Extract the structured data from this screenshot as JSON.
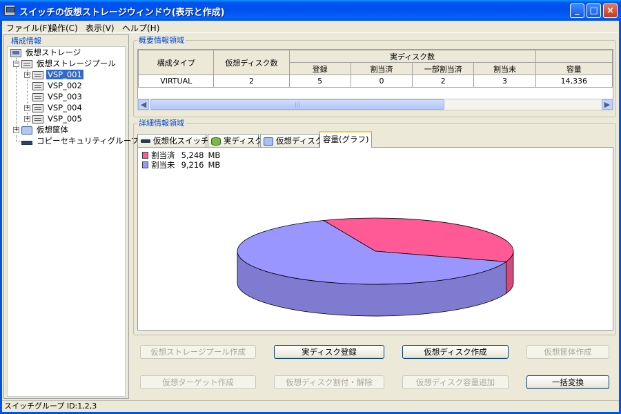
{
  "window": {
    "title": "スイッチの仮想ストレージウィンドウ(表示と作成)",
    "minimize": "_",
    "maximize": "□",
    "close": "×"
  },
  "menu": [
    "ファイル(F)",
    "操作(C)",
    "表示(V)",
    "ヘルプ(H)"
  ],
  "left": {
    "group_label": "構成情報",
    "tree": {
      "root": "仮想ストレージ",
      "pool": "仮想ストレージプール",
      "vsps": [
        "VSP_001",
        "VSP_002",
        "VSP_003",
        "VSP_004",
        "VSP_005"
      ],
      "selected": "VSP_001",
      "chassis": "仮想筐体",
      "copy_group": "コピーセキュリティグループ"
    }
  },
  "summary": {
    "group_label": "概要情報領域",
    "headers": {
      "config_type": "構成タイプ",
      "vdisk_count": "仮想ディスク数",
      "real_disk_count": "実ディスク数",
      "registered": "登録",
      "allocated": "割当済",
      "partial": "一部割当済",
      "unallocated": "割当未",
      "capacity": "容量"
    },
    "row": {
      "config_type": "VIRTUAL",
      "vdisk_count": "2",
      "registered": "5",
      "allocated": "0",
      "partial": "2",
      "unallocated": "3",
      "capacity": "14,336"
    },
    "scroll_grip": "|||"
  },
  "detail": {
    "group_label": "詳細情報領域",
    "tabs": [
      "仮想化スイッチ",
      "実ディスク",
      "仮想ディスク",
      "容量(グラフ)"
    ],
    "active_tab": 3
  },
  "chart_data": {
    "type": "pie",
    "series": [
      {
        "name": "割当済",
        "value": 5248,
        "unit": "MB",
        "value_label": "5,248",
        "color": "#ff5a96"
      },
      {
        "name": "割当未",
        "value": 9216,
        "unit": "MB",
        "value_label": "9,216",
        "color": "#9a96ff"
      }
    ],
    "legend_placement": "top-left"
  },
  "buttons": {
    "row1": [
      {
        "label": "仮想ストレージプール作成",
        "enabled": false
      },
      {
        "label": "実ディスク登録",
        "enabled": true
      },
      {
        "label": "仮想ディスク作成",
        "enabled": true
      },
      {
        "label": "仮想筐体作成",
        "enabled": false
      }
    ],
    "row2": [
      {
        "label": "仮想ターゲット作成",
        "enabled": false
      },
      {
        "label": "仮想ディスク割付・解除",
        "enabled": false
      },
      {
        "label": "仮想ディスク容量追加",
        "enabled": false
      },
      {
        "label": "一括変換",
        "enabled": true
      }
    ]
  },
  "status": "スイッチグループ ID:1,2,3"
}
